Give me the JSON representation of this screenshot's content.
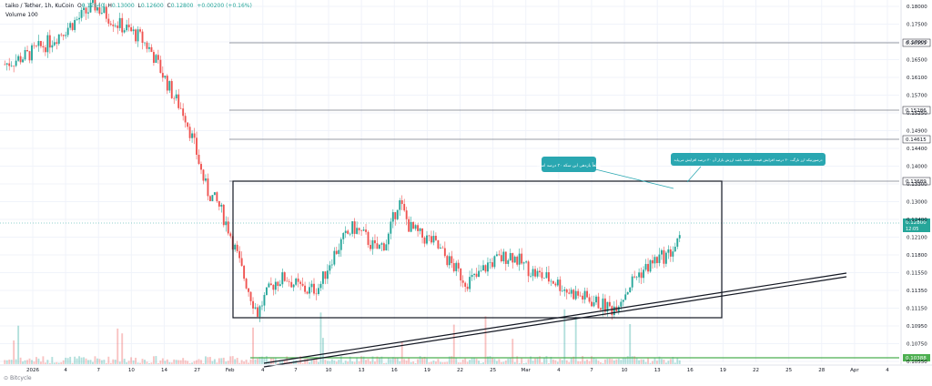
{
  "header": {
    "symbol": "taiko / Tether, 1h, KuCoin",
    "o_label": "O",
    "o_value": "0.12640",
    "h_label": "H",
    "h_value": "0.13000",
    "l_label": "L",
    "l_value": "0.12600",
    "c_label": "C",
    "c_value": "0.12800",
    "change": "+0.00200 (+0.16%)",
    "volume_label": "Volume",
    "volume_value": "100"
  },
  "branding": {
    "name": "Bitcycle"
  },
  "colors": {
    "up": "#26a69a",
    "down": "#ef5350",
    "grid": "#f0f3fa",
    "level_line": "#787b86",
    "callout": "#2aa7b1",
    "current_price_badge": "#26a69a",
    "support_line": "#4caf50"
  },
  "chart_data": {
    "type": "candlestick",
    "title": "taiko / Tether, 1h, KuCoin",
    "ylim": [
      0.1,
      0.18
    ],
    "y_axis_side": "right",
    "y_ticks": [
      "0.18000",
      "0.17500",
      "0.17000",
      "0.16500",
      "0.16100",
      "0.15700",
      "0.15250",
      "0.14900",
      "0.14400",
      "0.14000",
      "0.13300",
      "0.13000",
      "0.12400",
      "0.12100",
      "0.11800",
      "0.11550",
      "0.11350",
      "0.11150",
      "0.10950",
      "0.10750",
      "0.10550"
    ],
    "x_ticks": [
      "2026",
      "4",
      "7",
      "10",
      "14",
      "27",
      "Feb",
      "4",
      "7",
      "10",
      "13",
      "16",
      "19",
      "22",
      "25",
      "Mar",
      "4",
      "7",
      "10",
      "13",
      "16",
      "19",
      "22",
      "25",
      "28",
      "Apr",
      "4"
    ],
    "horizontal_levels": [
      {
        "price": 0.16953,
        "label": "0.16953"
      },
      {
        "price": 0.15286,
        "label": "0.15286"
      },
      {
        "price": 0.14615,
        "label": "0.14615"
      },
      {
        "price": 0.13689,
        "label": "0.13689"
      }
    ],
    "current_price": {
      "value": "0.12800",
      "countdown": "12:05"
    },
    "support_level": {
      "value": "0.10388"
    },
    "price_path": [
      [
        0,
        0.167
      ],
      [
        4,
        0.169
      ],
      [
        8,
        0.172
      ],
      [
        12,
        0.176
      ],
      [
        16,
        0.18
      ],
      [
        20,
        0.176
      ],
      [
        24,
        0.173
      ],
      [
        26,
        0.17
      ],
      [
        28,
        0.165
      ],
      [
        30,
        0.16
      ],
      [
        32,
        0.156
      ],
      [
        34,
        0.148
      ],
      [
        35,
        0.143
      ],
      [
        36,
        0.139
      ],
      [
        38,
        0.136
      ],
      [
        40,
        0.13
      ],
      [
        42,
        0.122
      ],
      [
        44,
        0.115
      ],
      [
        45,
        0.112
      ],
      [
        46,
        0.115
      ],
      [
        48,
        0.119
      ],
      [
        50,
        0.12
      ],
      [
        52,
        0.118
      ],
      [
        54,
        0.117
      ],
      [
        56,
        0.118
      ],
      [
        58,
        0.124
      ],
      [
        60,
        0.128
      ],
      [
        62,
        0.131
      ],
      [
        64,
        0.129
      ],
      [
        66,
        0.126
      ],
      [
        68,
        0.128
      ],
      [
        70,
        0.137
      ],
      [
        72,
        0.131
      ],
      [
        74,
        0.129
      ],
      [
        76,
        0.128
      ],
      [
        78,
        0.125
      ],
      [
        80,
        0.122
      ],
      [
        82,
        0.119
      ],
      [
        84,
        0.12
      ],
      [
        86,
        0.123
      ],
      [
        88,
        0.124
      ],
      [
        90,
        0.125
      ],
      [
        92,
        0.123
      ],
      [
        94,
        0.121
      ],
      [
        96,
        0.12
      ],
      [
        98,
        0.119
      ],
      [
        100,
        0.117
      ],
      [
        102,
        0.116
      ],
      [
        104,
        0.115
      ],
      [
        106,
        0.114
      ],
      [
        108,
        0.113
      ],
      [
        110,
        0.116
      ],
      [
        112,
        0.12
      ],
      [
        114,
        0.122
      ],
      [
        116,
        0.124
      ],
      [
        118,
        0.125
      ],
      [
        120,
        0.128
      ]
    ],
    "volume": "spiky, mostly small with occasional tall bars",
    "annotations": [
      {
        "type": "rectangle",
        "label": "range box"
      },
      {
        "type": "trendline",
        "label": "ascending double trendline"
      },
      {
        "type": "callout",
        "text": "قطعاً بازدهی این سکه ۳۰ درصد است"
      },
      {
        "type": "callout",
        "text": "درصورتیکه ارز تارگت ۳۰ درصد افزایش قیمت داشته باشد ارزش بازار آن ۳۰ درصد افزایش می‌یابد"
      }
    ]
  }
}
